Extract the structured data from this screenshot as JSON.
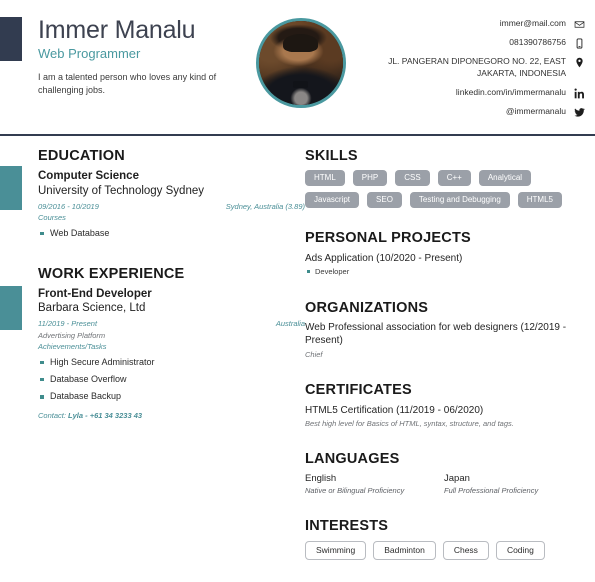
{
  "header": {
    "name": "Immer Manalu",
    "title": "Web Programmer",
    "summary": "I am a talented person who loves any kind of challenging jobs.",
    "avatar_alt": "profile-photo",
    "contacts": [
      {
        "icon": "mail-icon",
        "text": "immer@mail.com"
      },
      {
        "icon": "phone-icon",
        "text": "081390786756"
      },
      {
        "icon": "location-icon",
        "text": "JL. PANGERAN DIPONEGORO NO. 22, EAST JAKARTA, INDONESIA"
      },
      {
        "icon": "linkedin-icon",
        "text": "linkedin.com/in/immermanalu"
      },
      {
        "icon": "twitter-icon",
        "text": "@immermanalu"
      }
    ]
  },
  "left": {
    "education": {
      "heading": "EDUCATION",
      "degree": "Computer Science",
      "school": "University of Technology Sydney",
      "dates": "09/2016 - 10/2019",
      "location": "Sydney, Australia (3.89)",
      "courses_label": "Courses",
      "courses": [
        "Web Database"
      ]
    },
    "work": {
      "heading": "WORK EXPERIENCE",
      "position": "Front-End Developer",
      "company": "Barbara Science, Ltd",
      "dates": "11/2019 - Present",
      "location": "Australia",
      "department": "Advertising Platform",
      "achievements_label": "Achievements/Tasks",
      "achievements": [
        "High Secure Administrator",
        "Database Overflow",
        "Database Backup"
      ],
      "contact_label": "Contact:",
      "contact_value": "Lyla - +61 34 3233 43"
    }
  },
  "right": {
    "skills": {
      "heading": "SKILLS",
      "items": [
        "HTML",
        "PHP",
        "CSS",
        "C++",
        "Analytical",
        "Javascript",
        "SEO",
        "Testing and Debugging",
        "HTML5"
      ]
    },
    "projects": {
      "heading": "PERSONAL PROJECTS",
      "name": "Ads Application (10/2020 - Present)",
      "roles": [
        "Developer"
      ]
    },
    "organizations": {
      "heading": "ORGANIZATIONS",
      "name": "Web Professional association for web designers (12/2019 - Present)",
      "role": "Chief"
    },
    "certificates": {
      "heading": "CERTIFICATES",
      "name": "HTML5 Certification (11/2019 - 06/2020)",
      "description": "Best high level for Basics of HTML, syntax, structure, and tags."
    },
    "languages": {
      "heading": "LANGUAGES",
      "items": [
        {
          "name": "English",
          "level": "Native or Bilingual Proficiency"
        },
        {
          "name": "Japan",
          "level": "Full Professional Proficiency"
        }
      ]
    },
    "interests": {
      "heading": "INTERESTS",
      "items": [
        "Swimming",
        "Badminton",
        "Chess",
        "Coding"
      ]
    }
  },
  "colors": {
    "navy": "#323c50",
    "teal": "#4a8f97",
    "chip_gray": "#9ba0a8"
  }
}
